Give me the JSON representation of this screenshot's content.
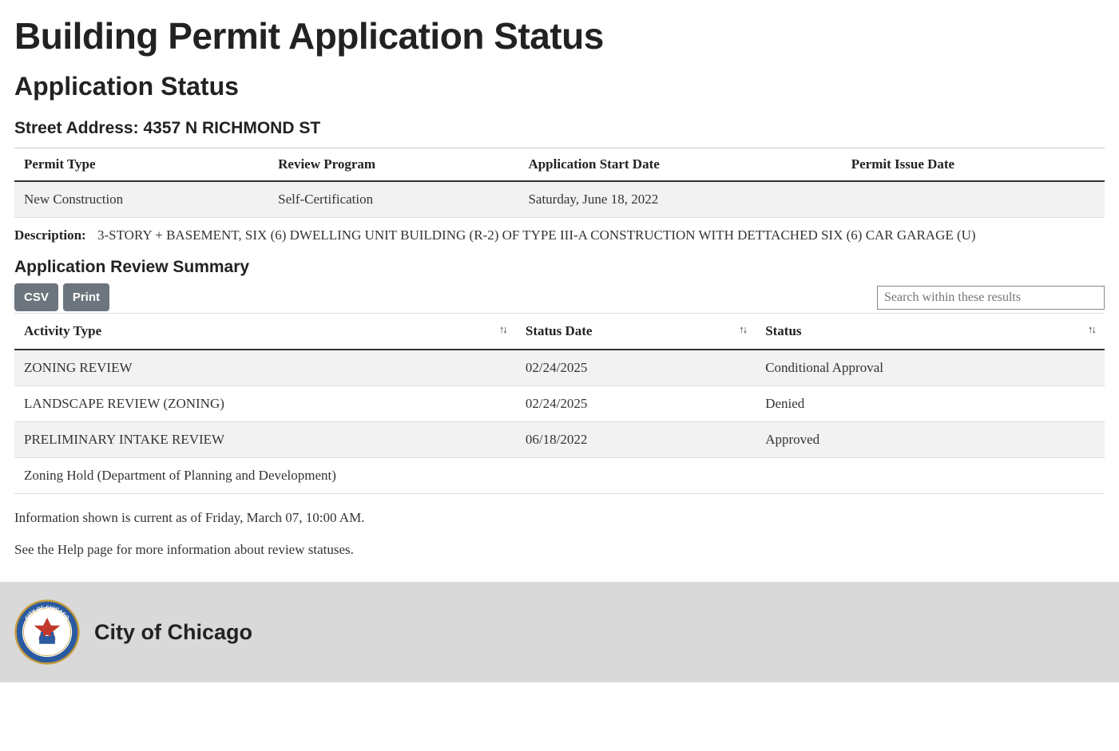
{
  "page_title": "Building Permit Application Status",
  "subheading": "Application Status",
  "address_label": "Street Address: ",
  "address_value": "4357 N RICHMOND ST",
  "permit_table": {
    "headers": [
      "Permit Type",
      "Review Program",
      "Application Start Date",
      "Permit Issue Date"
    ],
    "row": [
      "New Construction",
      "Self-Certification",
      "Saturday, June 18, 2022",
      ""
    ]
  },
  "description_label": "Description:",
  "description_value": "3-STORY + BASEMENT, SIX (6) DWELLING UNIT BUILDING (R-2) OF TYPE III-A CONSTRUCTION WITH DETTACHED SIX (6) CAR GARAGE (U)",
  "review_summary_heading": "Application Review Summary",
  "toolbar": {
    "csv_label": "CSV",
    "print_label": "Print",
    "search_placeholder": "Search within these results"
  },
  "review_table": {
    "headers": [
      "Activity Type",
      "Status Date",
      "Status"
    ],
    "rows": [
      {
        "activity": "ZONING REVIEW",
        "date": "02/24/2025",
        "status": "Conditional Approval"
      },
      {
        "activity": "LANDSCAPE REVIEW (ZONING)",
        "date": "02/24/2025",
        "status": "Denied"
      },
      {
        "activity": "PRELIMINARY INTAKE REVIEW",
        "date": "06/18/2022",
        "status": "Approved"
      }
    ],
    "hold_row": "Zoning Hold (Department of Planning and Development)"
  },
  "info_line1": "Information shown is current as of Friday, March 07, 10:00 AM.",
  "info_line2": "See the Help page for more information about review statuses.",
  "footer_text": "City of Chicago"
}
